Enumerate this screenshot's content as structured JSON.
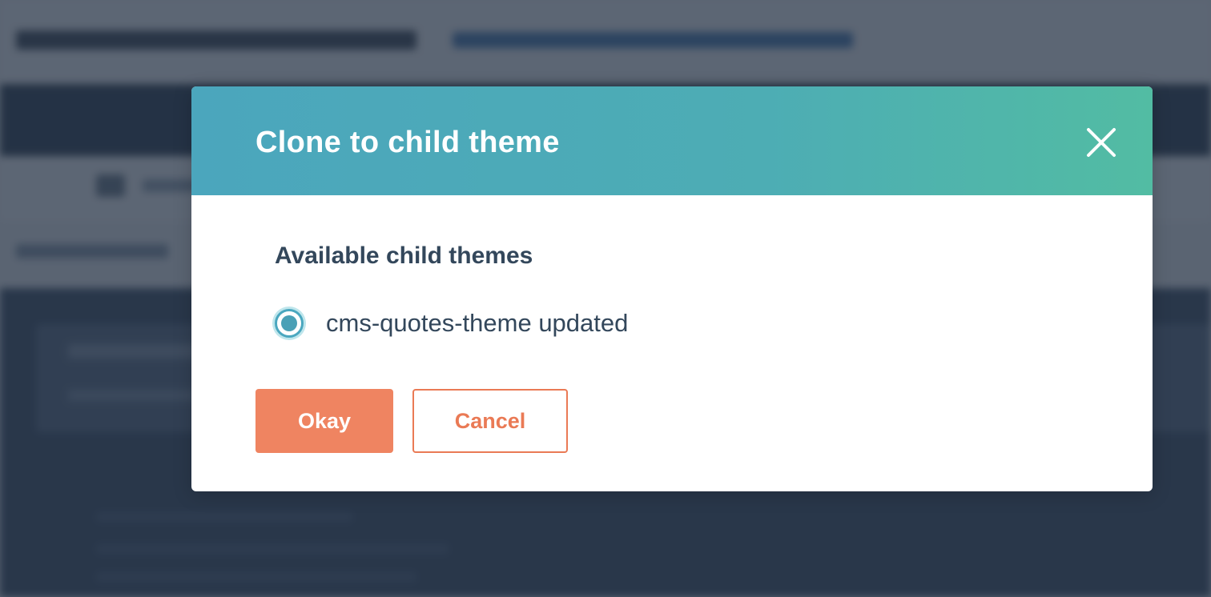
{
  "dialog": {
    "title": "Clone to child theme",
    "close_icon": "close-icon",
    "section_label": "Available child themes",
    "options": [
      {
        "label": "cms-quotes-theme updated",
        "selected": true
      }
    ],
    "buttons": {
      "okay": "Okay",
      "cancel": "Cancel"
    }
  },
  "colors": {
    "header_gradient_start": "#4ba6bd",
    "header_gradient_end": "#52bca3",
    "primary_button": "#ef8461",
    "secondary_button_border": "#ea7a55",
    "text_dark": "#33475b",
    "radio_accent": "#4aa7bf"
  }
}
